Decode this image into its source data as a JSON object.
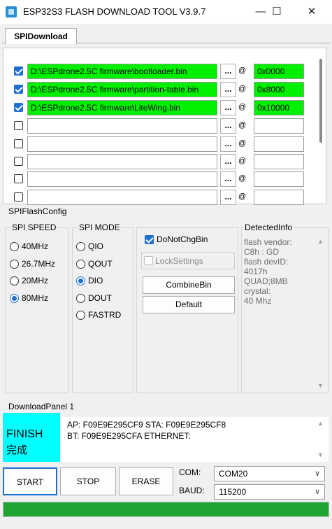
{
  "window": {
    "title": "ESP32S3 FLASH DOWNLOAD TOOL V3.9.7",
    "minimize": "—",
    "maximize": "☐",
    "close": "✕"
  },
  "tabs": [
    {
      "label": "SPIDownload",
      "selected": true
    }
  ],
  "file_rows": [
    {
      "checked": true,
      "path": "D:\\ESPdrone2.5C firmware\\bootloader.bin",
      "browse": "...",
      "at": "@",
      "address": "0x0000"
    },
    {
      "checked": true,
      "path": "D:\\ESPdrone2.5C firmware\\partition-table.bin",
      "browse": "...",
      "at": "@",
      "address": "0x8000"
    },
    {
      "checked": true,
      "path": "D:\\ESPdrone2.5C firmware\\LiteWing.bin",
      "browse": "...",
      "at": "@",
      "address": "0x10000"
    },
    {
      "checked": false,
      "path": "",
      "browse": "...",
      "at": "@",
      "address": ""
    },
    {
      "checked": false,
      "path": "",
      "browse": "...",
      "at": "@",
      "address": ""
    },
    {
      "checked": false,
      "path": "",
      "browse": "...",
      "at": "@",
      "address": ""
    },
    {
      "checked": false,
      "path": "",
      "browse": "...",
      "at": "@",
      "address": ""
    },
    {
      "checked": false,
      "path": "",
      "browse": "...",
      "at": "@",
      "address": ""
    }
  ],
  "spi_flash_config": {
    "label": "SPIFlashConfig",
    "spi_speed": {
      "label": "SPI SPEED",
      "options": [
        "40MHz",
        "26.7MHz",
        "20MHz",
        "80MHz"
      ],
      "selected": "80MHz"
    },
    "spi_mode": {
      "label": "SPI MODE",
      "options": [
        "QIO",
        "QOUT",
        "DIO",
        "DOUT",
        "FASTRD"
      ],
      "selected": "DIO"
    },
    "do_not_chg_bin": {
      "label": "DoNotChgBin",
      "checked": true
    },
    "lock_settings": {
      "label": "LockSettings",
      "checked": false
    },
    "combine_bin_label": "CombineBin",
    "default_label": "Default",
    "detected_info": {
      "label": "DetectedInfo",
      "text": "flash vendor:\nC8h : GD\nflash devID:\n4017h\nQUAD;8MB\ncrystal:\n40 Mhz"
    }
  },
  "download_panel": {
    "label": "DownloadPanel 1",
    "status_en": "FINISH",
    "status_cn": "完成",
    "status_color": "#00ffff",
    "info_line1": "AP:  F09E9E295CF9  STA:  F09E9E295CF8",
    "info_line2": "BT:  F09E9E295CFA  ETHERNET:",
    "start_label": "START",
    "stop_label": "STOP",
    "erase_label": "ERASE",
    "com_label": "COM:",
    "com_value": "COM20",
    "baud_label": "BAUD:",
    "baud_value": "115200",
    "progress": 1.0,
    "progress_color": "#1ea532"
  }
}
